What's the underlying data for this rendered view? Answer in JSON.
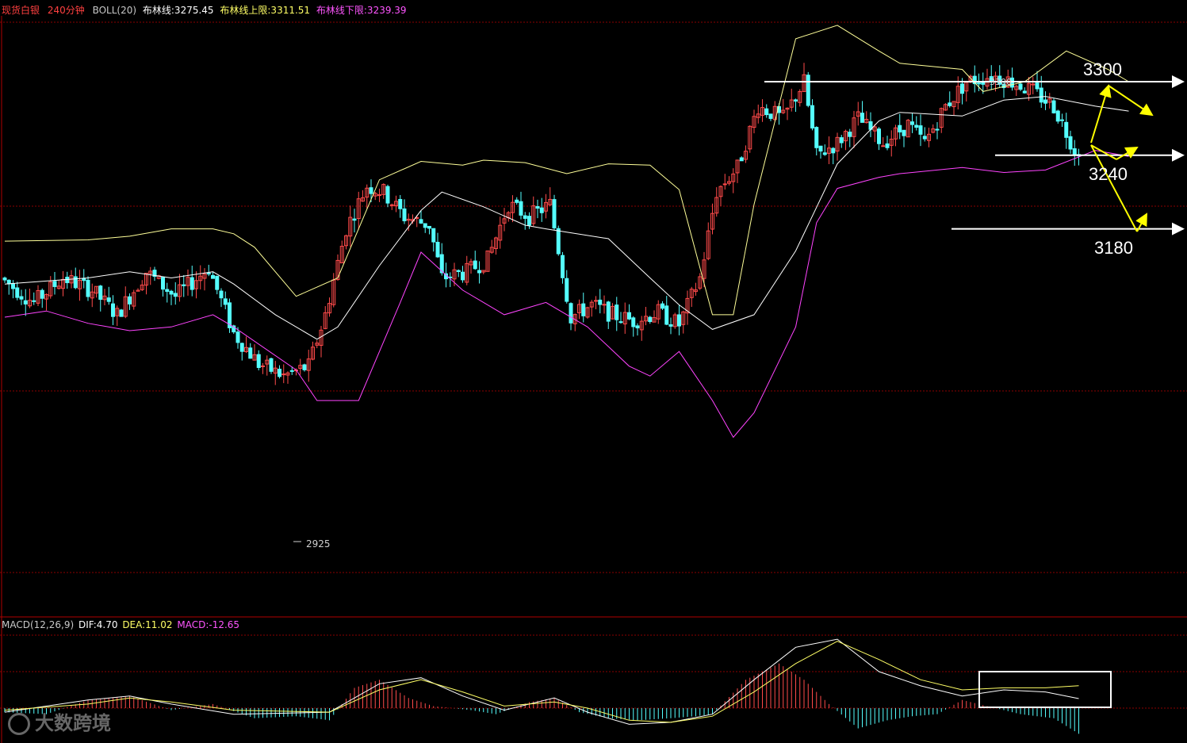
{
  "header": {
    "instrument": "现货白银",
    "period": "240分钟",
    "indicator": "BOLL(20)",
    "mid_label": "布林线:3275.45",
    "upper_label": "布林线上限:3311.51",
    "lower_label": "布林线下限:3239.39"
  },
  "macd_header": {
    "name": "MACD(12,26,9)",
    "dif": "DIF:4.70",
    "dea": "DEA:11.02",
    "macd": "MACD:-12.65"
  },
  "annotations": {
    "resistance": "3300",
    "pivot": "3240",
    "support": "3180",
    "low_mark": "2925",
    "high_mark": "3300"
  },
  "watermark": "大数跨境",
  "colors": {
    "up": "#ff4a4a",
    "down": "#54ffff",
    "upper_band": "#ffff99",
    "mid_band": "#ffffff",
    "lower_band": "#ff44ff",
    "grid": "#8b0000",
    "arrow": "#ffff00",
    "level": "#ffffff"
  },
  "chart_data": {
    "type": "candlestick",
    "title": "现货白银 240分钟",
    "ylim": [
      2860,
      3360
    ],
    "levels": [
      3300,
      3240,
      3180
    ],
    "boll_upper_points": [
      [
        0,
        3170
      ],
      [
        20,
        3171
      ],
      [
        30,
        3174
      ],
      [
        40,
        3180
      ],
      [
        50,
        3180
      ],
      [
        55,
        3176
      ],
      [
        60,
        3165
      ],
      [
        70,
        3125
      ],
      [
        80,
        3140
      ],
      [
        90,
        3220
      ],
      [
        100,
        3235
      ],
      [
        110,
        3232
      ],
      [
        115,
        3236
      ],
      [
        125,
        3234
      ],
      [
        135,
        3225
      ],
      [
        145,
        3233
      ],
      [
        155,
        3232
      ],
      [
        162,
        3212
      ],
      [
        170,
        3110
      ],
      [
        175,
        3110
      ],
      [
        180,
        3200
      ],
      [
        190,
        3335
      ],
      [
        200,
        3346
      ],
      [
        210,
        3325
      ],
      [
        215,
        3315
      ],
      [
        230,
        3310
      ],
      [
        235,
        3292
      ],
      [
        245,
        3300
      ],
      [
        255,
        3325
      ],
      [
        265,
        3310
      ],
      [
        270,
        3300
      ]
    ],
    "boll_mid_points": [
      [
        0,
        3135
      ],
      [
        20,
        3140
      ],
      [
        30,
        3145
      ],
      [
        40,
        3140
      ],
      [
        50,
        3145
      ],
      [
        55,
        3135
      ],
      [
        65,
        3110
      ],
      [
        75,
        3090
      ],
      [
        80,
        3100
      ],
      [
        90,
        3150
      ],
      [
        100,
        3195
      ],
      [
        105,
        3210
      ],
      [
        115,
        3198
      ],
      [
        125,
        3183
      ],
      [
        130,
        3180
      ],
      [
        145,
        3172
      ],
      [
        155,
        3140
      ],
      [
        162,
        3118
      ],
      [
        170,
        3098
      ],
      [
        180,
        3110
      ],
      [
        190,
        3162
      ],
      [
        200,
        3233
      ],
      [
        210,
        3268
      ],
      [
        215,
        3275
      ],
      [
        230,
        3272
      ],
      [
        240,
        3285
      ],
      [
        250,
        3288
      ],
      [
        262,
        3280
      ],
      [
        270,
        3276
      ]
    ],
    "boll_lower_points": [
      [
        0,
        3108
      ],
      [
        10,
        3113
      ],
      [
        20,
        3103
      ],
      [
        30,
        3097
      ],
      [
        40,
        3100
      ],
      [
        50,
        3110
      ],
      [
        55,
        3100
      ],
      [
        70,
        3065
      ],
      [
        75,
        3040
      ],
      [
        85,
        3040
      ],
      [
        95,
        3120
      ],
      [
        100,
        3161
      ],
      [
        110,
        3130
      ],
      [
        120,
        3110
      ],
      [
        130,
        3120
      ],
      [
        140,
        3100
      ],
      [
        150,
        3068
      ],
      [
        155,
        3060
      ],
      [
        162,
        3080
      ],
      [
        170,
        3040
      ],
      [
        175,
        3010
      ],
      [
        180,
        3030
      ],
      [
        190,
        3100
      ],
      [
        195,
        3185
      ],
      [
        200,
        3213
      ],
      [
        210,
        3222
      ],
      [
        215,
        3225
      ],
      [
        230,
        3230
      ],
      [
        240,
        3226
      ],
      [
        250,
        3228
      ],
      [
        262,
        3244
      ],
      [
        270,
        3239
      ]
    ],
    "anchors": [
      [
        0,
        3140
      ],
      [
        8,
        3120
      ],
      [
        15,
        3140
      ],
      [
        22,
        3130
      ],
      [
        28,
        3110
      ],
      [
        35,
        3145
      ],
      [
        42,
        3125
      ],
      [
        50,
        3148
      ],
      [
        56,
        3095
      ],
      [
        62,
        3070
      ],
      [
        68,
        3060
      ],
      [
        74,
        3068
      ],
      [
        78,
        3110
      ],
      [
        83,
        3180
      ],
      [
        88,
        3215
      ],
      [
        92,
        3210
      ],
      [
        97,
        3190
      ],
      [
        103,
        3183
      ],
      [
        106,
        3140
      ],
      [
        112,
        3145
      ],
      [
        117,
        3155
      ],
      [
        122,
        3200
      ],
      [
        127,
        3190
      ],
      [
        132,
        3200
      ],
      [
        137,
        3108
      ],
      [
        142,
        3118
      ],
      [
        147,
        3110
      ],
      [
        152,
        3105
      ],
      [
        158,
        3112
      ],
      [
        163,
        3102
      ],
      [
        168,
        3140
      ],
      [
        172,
        3210
      ],
      [
        177,
        3230
      ],
      [
        182,
        3280
      ],
      [
        188,
        3270
      ],
      [
        193,
        3300
      ],
      [
        196,
        3240
      ],
      [
        201,
        3250
      ],
      [
        206,
        3270
      ],
      [
        212,
        3250
      ],
      [
        218,
        3265
      ],
      [
        222,
        3250
      ],
      [
        227,
        3280
      ],
      [
        232,
        3300
      ],
      [
        238,
        3305
      ],
      [
        243,
        3300
      ],
      [
        248,
        3292
      ],
      [
        253,
        3280
      ],
      [
        258,
        3245
      ]
    ],
    "macd_hist_anchors": [
      [
        0,
        -2
      ],
      [
        10,
        -3
      ],
      [
        20,
        4
      ],
      [
        30,
        6
      ],
      [
        40,
        -1
      ],
      [
        50,
        2
      ],
      [
        60,
        -5
      ],
      [
        70,
        -4
      ],
      [
        78,
        -6
      ],
      [
        84,
        10
      ],
      [
        90,
        14
      ],
      [
        97,
        5
      ],
      [
        103,
        1
      ],
      [
        112,
        -1
      ],
      [
        118,
        -3
      ],
      [
        126,
        3
      ],
      [
        132,
        5
      ],
      [
        138,
        -2
      ],
      [
        145,
        -5
      ],
      [
        152,
        -6
      ],
      [
        160,
        -5
      ],
      [
        166,
        -4
      ],
      [
        170,
        -3
      ],
      [
        178,
        14
      ],
      [
        186,
        22
      ],
      [
        192,
        14
      ],
      [
        198,
        2
      ],
      [
        205,
        -10
      ],
      [
        212,
        -6
      ],
      [
        218,
        -4
      ],
      [
        224,
        -3
      ],
      [
        230,
        4
      ],
      [
        236,
        1
      ],
      [
        244,
        -3
      ],
      [
        252,
        -5
      ],
      [
        258,
        -12.65
      ]
    ],
    "dif_points": [
      [
        0,
        -2
      ],
      [
        20,
        4
      ],
      [
        30,
        6
      ],
      [
        40,
        2
      ],
      [
        55,
        -3
      ],
      [
        78,
        -2
      ],
      [
        90,
        12
      ],
      [
        100,
        15
      ],
      [
        110,
        6
      ],
      [
        120,
        -1
      ],
      [
        132,
        5
      ],
      [
        140,
        -2
      ],
      [
        150,
        -8
      ],
      [
        160,
        -7
      ],
      [
        170,
        -3
      ],
      [
        180,
        14
      ],
      [
        190,
        30
      ],
      [
        200,
        34
      ],
      [
        210,
        18
      ],
      [
        220,
        11
      ],
      [
        230,
        6
      ],
      [
        240,
        9
      ],
      [
        250,
        8
      ],
      [
        258,
        4.7
      ]
    ],
    "dea_points": [
      [
        0,
        -1
      ],
      [
        20,
        2
      ],
      [
        30,
        5
      ],
      [
        40,
        3
      ],
      [
        55,
        -1
      ],
      [
        78,
        -2
      ],
      [
        90,
        9
      ],
      [
        100,
        14
      ],
      [
        110,
        8
      ],
      [
        120,
        1
      ],
      [
        132,
        3
      ],
      [
        140,
        0
      ],
      [
        150,
        -6
      ],
      [
        160,
        -7
      ],
      [
        170,
        -4
      ],
      [
        180,
        8
      ],
      [
        190,
        22
      ],
      [
        200,
        33
      ],
      [
        210,
        24
      ],
      [
        220,
        14
      ],
      [
        230,
        9
      ],
      [
        240,
        10
      ],
      [
        250,
        10
      ],
      [
        258,
        11.02
      ]
    ],
    "macd_ylim": [
      -15,
      36
    ]
  }
}
